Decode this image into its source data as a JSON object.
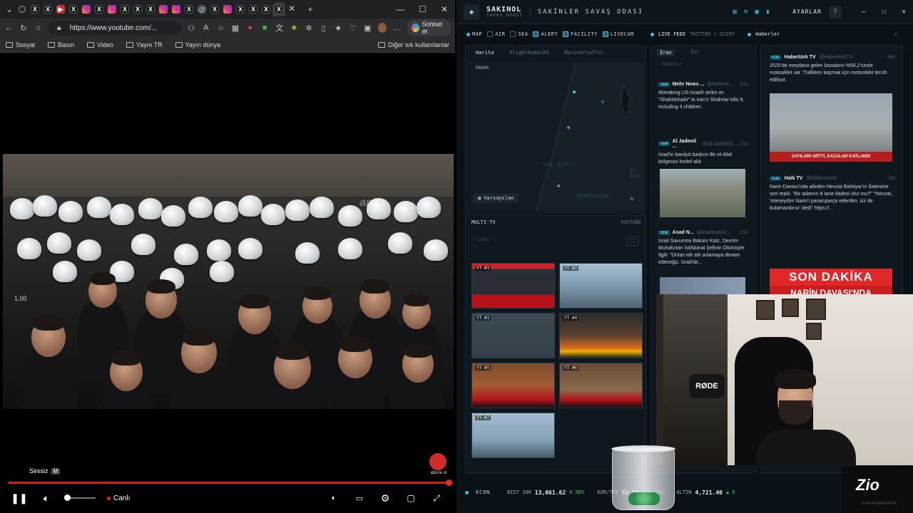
{
  "browser": {
    "tabs": [
      {
        "kind": "x",
        "glyph": "X"
      },
      {
        "kind": "x",
        "glyph": "X"
      },
      {
        "kind": "yt",
        "glyph": "▶"
      },
      {
        "kind": "x",
        "glyph": "X"
      },
      {
        "kind": "ig",
        "glyph": ""
      },
      {
        "kind": "x",
        "glyph": "X"
      },
      {
        "kind": "ig",
        "glyph": ""
      },
      {
        "kind": "x",
        "glyph": "X"
      },
      {
        "kind": "x",
        "glyph": "X"
      },
      {
        "kind": "x",
        "glyph": "X"
      },
      {
        "kind": "ig",
        "glyph": ""
      },
      {
        "kind": "ig",
        "glyph": ""
      },
      {
        "kind": "x",
        "glyph": "X"
      },
      {
        "kind": "th",
        "glyph": "@"
      },
      {
        "kind": "x",
        "glyph": "X"
      },
      {
        "kind": "ig",
        "glyph": ""
      },
      {
        "kind": "x",
        "glyph": "X"
      },
      {
        "kind": "x",
        "glyph": "X"
      },
      {
        "kind": "x",
        "glyph": "X"
      },
      {
        "kind": "x",
        "glyph": "X"
      }
    ],
    "url": "https://www.youtube.com/...",
    "copilot_label": "Sohbet et",
    "bookmarks": [
      "Sosyal",
      "Basın",
      "Video",
      "Yayın TR",
      "Yayın dünya"
    ],
    "bookmarks_other": "Diğer sık kullanılanlar"
  },
  "video": {
    "timestamp_overlay": "1.00",
    "watermark": "anka",
    "channel_bug": "abone ol",
    "muted_tooltip": "Sessiz",
    "muted_key": "M",
    "live_label": "Canlı",
    "progress": 1.0
  },
  "dashboard": {
    "brand_name": "SAKINOL",
    "brand_sub": "SAVAŞ ODASI",
    "title": "SAKİNLER SAVAŞ ODASI",
    "settings_label": "AYARLAR",
    "help": "?",
    "layers": [
      {
        "label": "MAP",
        "checked": false,
        "led": true
      },
      {
        "label": "AIR",
        "checked": false
      },
      {
        "label": "SEA",
        "checked": false
      },
      {
        "label": "ALERT",
        "checked": true
      },
      {
        "label": "FACILITY",
        "checked": true
      },
      {
        "label": "LIVECAM",
        "checked": true
      }
    ],
    "map": {
      "tabs": [
        "Harita",
        "FlightRadar24",
        "MarineTraffic"
      ],
      "radar_label": "RADAR",
      "cities": [
        "TEL AVIV",
        "JERUSALEM",
        "Al Bat"
      ],
      "reset_button": "Varsayılan"
    },
    "multitv": {
      "title": "MULTI-TV",
      "source": "YOUTUBE",
      "sub": "7 KANAL",
      "tiles": [
        "YT #1",
        "YT #2",
        "YT #3",
        "YT #4",
        "YT #5",
        "YT #6",
        "YT #7"
      ]
    },
    "live_feed": {
      "title": "LIVE FEED",
      "subtitle": "TWITTER / OSINT",
      "tabs": [
        "İran",
        "İsr"
      ],
      "sub": "Haberler",
      "items": [
        {
          "badge": "YENİ",
          "name": "Mehr News ...",
          "handle": "@Mehrne...",
          "age": "21s",
          "text": "#breaking US-Israeli strike on \"Shahidshahr\" in Iran's Shahriar kills 9, including 4 children."
        },
        {
          "badge": "YENİ",
          "name": "Al Jadeed ...",
          "handle": "@ALJADEED...",
          "age": "21s",
          "text": "İsrail'in baniiyō baskını Bir el-Abd bölgesini hedef aldı"
        },
        {
          "badge": "YENİ",
          "name": "Asad N...",
          "handle": "@asadnasir2...",
          "age": "21s",
          "text": "İsrail Savunma Bakanı Katz, Devrim Muhafızları İstihbarat Şefinin Ölümüyle İlgili: \"Onlan tek tek avlamaya devam edeceğiz. İsrail'de..."
        }
      ]
    },
    "news": {
      "title": "Haberler",
      "items": [
        {
          "badge": "YENİ",
          "source": "Habertürk TV",
          "handle": "@HaberturkTV",
          "age": "44s",
          "text": "2025'de meydana gelen kazaların %50,2'sinde motosiklet var. Trafikten kaçmak için motosiklet tercih ediliyor."
        },
        {
          "badge": "YENİ",
          "source": "Halk TV",
          "handle": "@halktvcomtr",
          "age": "13s",
          "text": "Narin Davası'nda aileden Nevzat Bahtiyar'ın ifadesine sert tepki: \"Bir adamın 8 tane ifadesi olur mu?\" \"Nevzat, 'isteseydim Narin'i paramparça ederdim, siz de bulamazdınız' dedi\" https://..."
        }
      ],
      "breaking_title": "SON DAKİKA",
      "breaking_body": "NARİN DAVASI'NDA GERGİNLİK! GÜRAN AİLESİ SALONDAN ÇIKARILDI",
      "thumb_banner": "SAYILARI ARTTI, KAZALAR KATLANDI"
    },
    "ticker": {
      "label": "ECON",
      "items": [
        {
          "name": "BIST 100",
          "value": "13,061.62",
          "change": "0.98%"
        },
        {
          "name": "EUR/TRY",
          "value": "51.59",
          "change": "▲ 0.45%"
        },
        {
          "name": "ALTIN",
          "value": "4,721.40",
          "change": "▲ 0"
        }
      ]
    },
    "camera": {
      "mic_brand": "RØDE"
    },
    "logo": {
      "text": "Zio",
      "sub": "ZURAKSAKINOL"
    }
  },
  "colors": {
    "accent": "#4fb6d8",
    "live_red": "#e52222",
    "yt_red": "#d81b1b",
    "up_green": "#3ec97a"
  }
}
